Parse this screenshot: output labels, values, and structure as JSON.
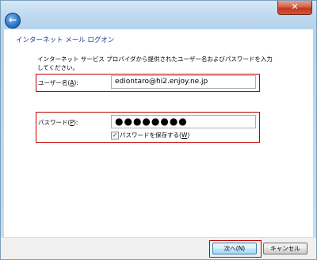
{
  "window": {
    "close_glyph": "✕",
    "back_glyph": "←",
    "title": "インターネット メール ログオン"
  },
  "form": {
    "description": "インターネット サービス プロバイダから提供されたユーザー名およびパスワードを入力してください。",
    "username_label": "ユーザー名(A):",
    "username_label_parts": {
      "before": "ユーザー名(",
      "key": "A",
      "after": "):"
    },
    "username_value": "ediontaro@hi2.enjoy.ne.jp",
    "password_label": "パスワード(P):",
    "password_label_parts": {
      "before": "パスワード(",
      "key": "P",
      "after": "):"
    },
    "password_mask": "●●●●●●●●",
    "remember_password": {
      "checked": true,
      "check_glyph": "✓",
      "label": "パスワードを保存する(W)",
      "label_parts": {
        "before": "パスワードを保存する(",
        "key": "W",
        "after": ")"
      }
    }
  },
  "footer": {
    "next_label": "次へ(N)",
    "cancel_label": "キャンセル"
  },
  "colors": {
    "highlight_border": "#c00000",
    "title_text": "#1e3a8f"
  }
}
